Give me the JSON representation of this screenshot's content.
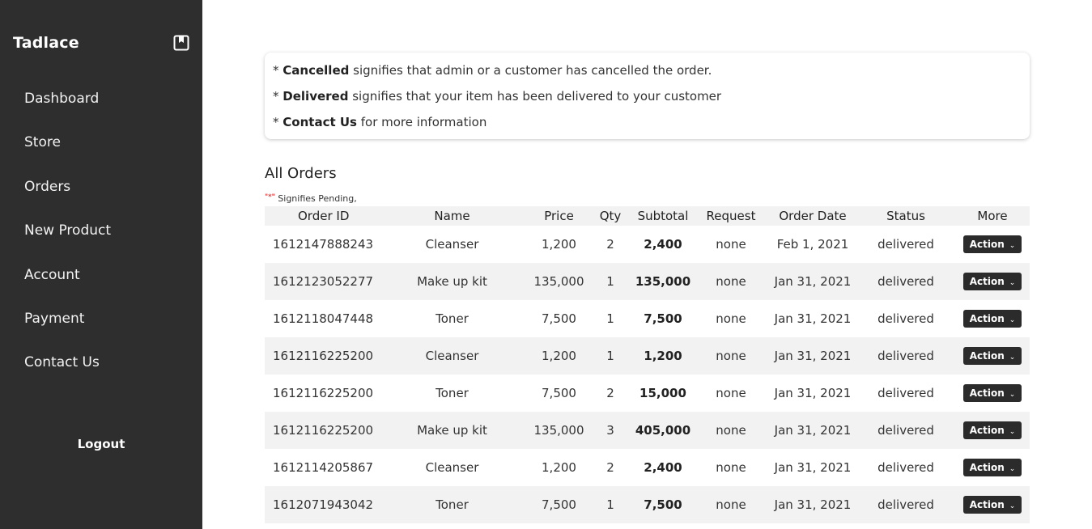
{
  "sidebar": {
    "brand": "Tadlace",
    "brand_icon": "bookmark-square-icon",
    "items": [
      {
        "label": "Dashboard"
      },
      {
        "label": "Store"
      },
      {
        "label": "Orders"
      },
      {
        "label": "New Product"
      },
      {
        "label": "Account"
      },
      {
        "label": "Payment"
      },
      {
        "label": "Contact Us"
      }
    ],
    "logout": "Logout"
  },
  "info": {
    "lines": [
      {
        "prefix": "* ",
        "bold": "Cancelled",
        "rest": " signifies that admin or a customer has cancelled the order."
      },
      {
        "prefix": "* ",
        "bold": "Delivered",
        "rest": " signifies that your item has been delivered to your customer"
      },
      {
        "prefix": "* ",
        "bold": "Contact Us",
        "rest": " for more information"
      }
    ]
  },
  "orders": {
    "title": "All Orders",
    "pending_mark": "\"*\"",
    "pending_text": " Signifies Pending,",
    "columns": [
      "Order ID",
      "Name",
      "Price",
      "Qty",
      "Subtotal",
      "Request",
      "Order Date",
      "Status",
      "More"
    ],
    "action_label": "Action",
    "rows": [
      {
        "id": "1612147888243",
        "name": "Cleanser",
        "price": "1,200",
        "qty": "2",
        "subtotal": "2,400",
        "request": "none",
        "date": "Feb 1, 2021",
        "status": "delivered"
      },
      {
        "id": "1612123052277",
        "name": "Make up kit",
        "price": "135,000",
        "qty": "1",
        "subtotal": "135,000",
        "request": "none",
        "date": "Jan 31, 2021",
        "status": "delivered"
      },
      {
        "id": "1612118047448",
        "name": "Toner",
        "price": "7,500",
        "qty": "1",
        "subtotal": "7,500",
        "request": "none",
        "date": "Jan 31, 2021",
        "status": "delivered"
      },
      {
        "id": "1612116225200",
        "name": "Cleanser",
        "price": "1,200",
        "qty": "1",
        "subtotal": "1,200",
        "request": "none",
        "date": "Jan 31, 2021",
        "status": "delivered"
      },
      {
        "id": "1612116225200",
        "name": "Toner",
        "price": "7,500",
        "qty": "2",
        "subtotal": "15,000",
        "request": "none",
        "date": "Jan 31, 2021",
        "status": "delivered"
      },
      {
        "id": "1612116225200",
        "name": "Make up kit",
        "price": "135,000",
        "qty": "3",
        "subtotal": "405,000",
        "request": "none",
        "date": "Jan 31, 2021",
        "status": "delivered"
      },
      {
        "id": "1612114205867",
        "name": "Cleanser",
        "price": "1,200",
        "qty": "2",
        "subtotal": "2,400",
        "request": "none",
        "date": "Jan 31, 2021",
        "status": "delivered"
      },
      {
        "id": "1612071943042",
        "name": "Toner",
        "price": "7,500",
        "qty": "1",
        "subtotal": "7,500",
        "request": "none",
        "date": "Jan 31, 2021",
        "status": "delivered"
      }
    ]
  }
}
